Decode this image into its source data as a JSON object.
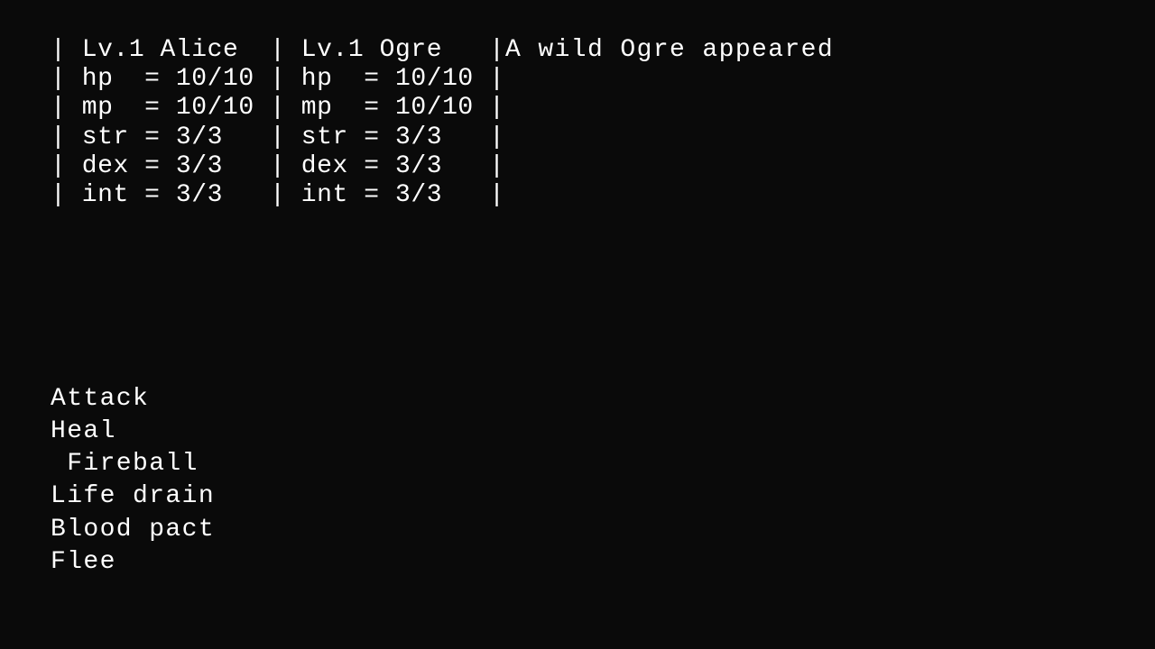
{
  "battle": {
    "message": "A wild Ogre appeared"
  },
  "stats": {
    "lines": [
      "| Lv.1 Alice  | Lv.1 Ogre   |",
      "| hp  = 10/10 | hp  = 10/10 |",
      "| mp  = 10/10 | mp  = 10/10 |",
      "| str = 3/3   | str = 3/3   |",
      "| dex = 3/3   | dex = 3/3   |",
      "| int = 3/3   | int = 3/3   |"
    ]
  },
  "actions": {
    "items": [
      {
        "label": "Attack",
        "indent": false
      },
      {
        "label": "Heal",
        "indent": false
      },
      {
        "label": " Fireball",
        "indent": true
      },
      {
        "label": "Life drain",
        "indent": false
      },
      {
        "label": "Blood pact",
        "indent": false
      },
      {
        "label": "Flee",
        "indent": false
      }
    ]
  }
}
